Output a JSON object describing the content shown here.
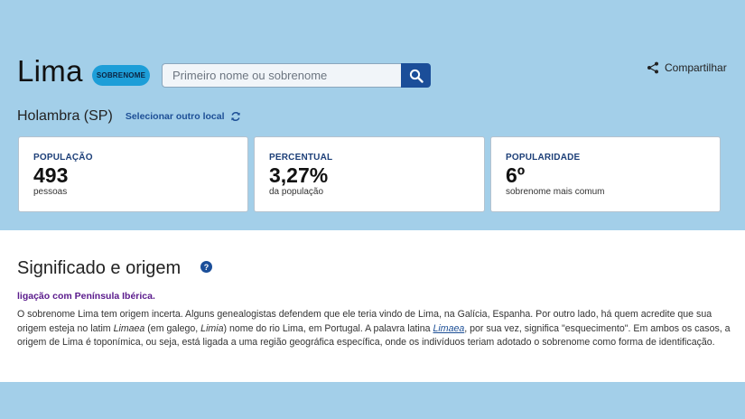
{
  "header": {
    "title": "Lima",
    "badge": "SOBRENOME",
    "search": {
      "placeholder": "Primeiro nome ou sobrenome",
      "value": ""
    },
    "share_label": "Compartilhar"
  },
  "location": {
    "name": "Holambra (SP)",
    "change_label": "Selecionar outro local"
  },
  "stats": [
    {
      "label": "POPULAÇÃO",
      "value": "493",
      "sub": "pessoas"
    },
    {
      "label": "PERCENTUAL",
      "value": "3,27%",
      "sub": "da população"
    },
    {
      "label": "POPULARIDADE",
      "value": "6º",
      "sub": "sobrenome mais comum"
    }
  ],
  "meaning": {
    "title": "Significado e origem",
    "help_icon": "?",
    "tag": "ligação com Península Ibérica.",
    "p1": "O sobrenome Lima tem origem incerta. Alguns genealogistas defendem que ele teria vindo de Lima, na Galícia, Espanha. Por outro lado, há quem acredite que sua origem esteja no latim ",
    "em1": "Limaea",
    "p2": " (em galego, ",
    "em2": "Limia",
    "p3": ") nome do rio Lima, em Portugal. A palavra latina ",
    "link": "Limaea",
    "p4": ", por sua vez, significa \"esquecimento\". Em ambos os casos, a origem de Lima é toponímica, ou seja, está ligada a uma região geográfica específica, onde os indivíduos teriam adotado o sobrenome como forma de identificação."
  },
  "colors": {
    "background": "#a3cfe9",
    "accent": "#1b4e99",
    "badge": "#1d9ed8",
    "tag": "#5a1a8c"
  }
}
